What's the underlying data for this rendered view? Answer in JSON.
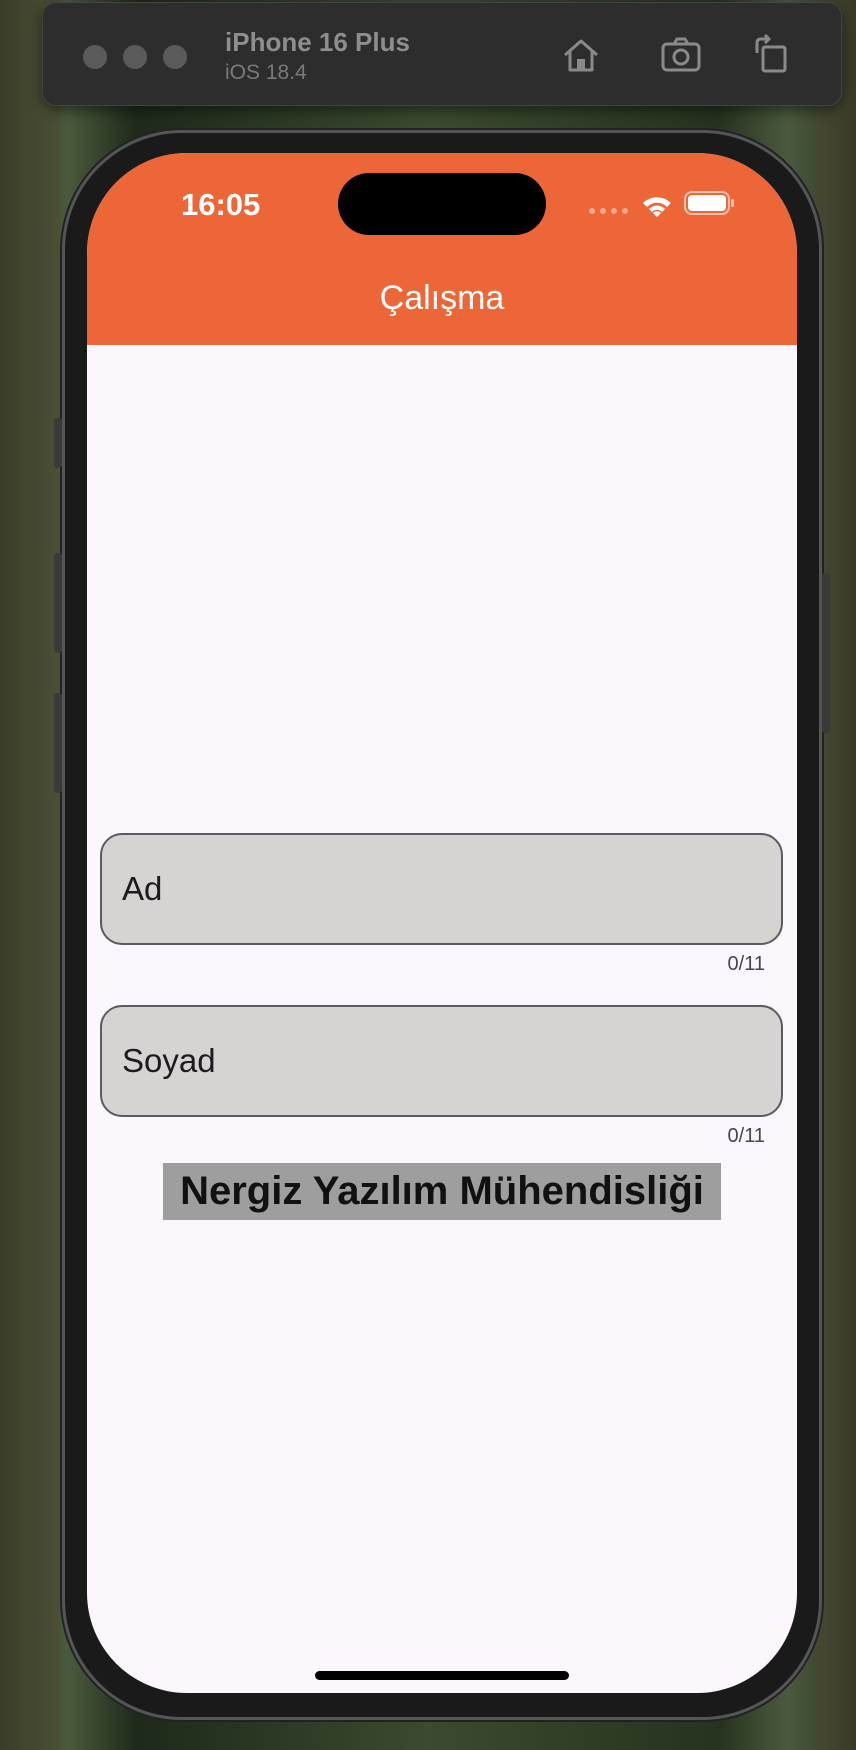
{
  "simulator": {
    "device_name": "iPhone 16 Plus",
    "os_version": "iOS 18.4",
    "icons": [
      "home-icon",
      "screenshot-icon",
      "rotate-icon"
    ]
  },
  "status_bar": {
    "time": "16:05",
    "icons": [
      "wifi-icon",
      "battery-icon"
    ]
  },
  "app": {
    "title": "Çalışma",
    "accent_color": "#ec6638",
    "background_color": "#fcf7fd"
  },
  "form": {
    "first_name": {
      "placeholder": "Ad",
      "counter": "0/11"
    },
    "last_name": {
      "placeholder": "Soyad",
      "counter": "0/11"
    }
  },
  "banner": {
    "text": "Nergiz Yazılım Mühendisliği"
  }
}
